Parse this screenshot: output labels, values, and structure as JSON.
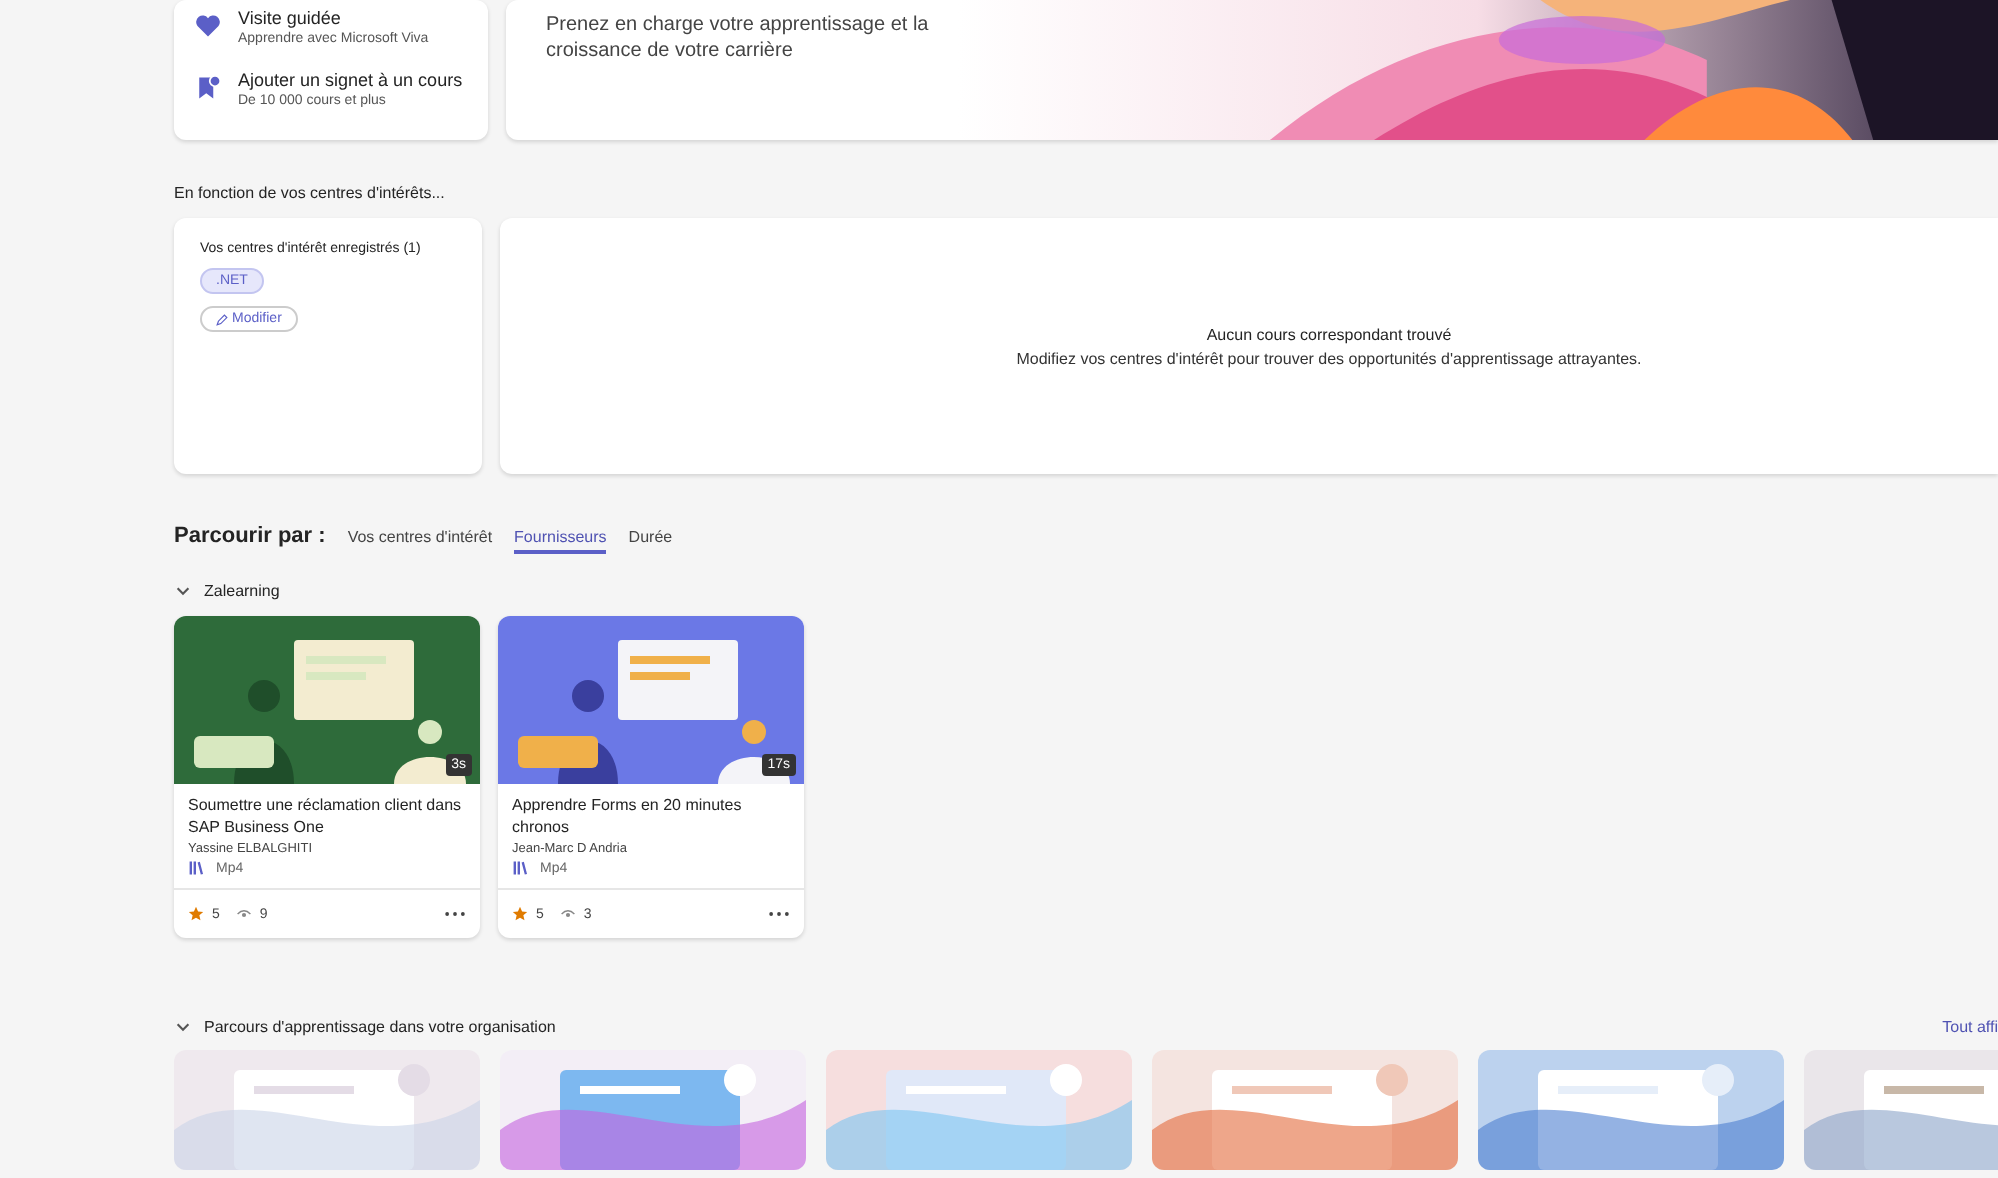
{
  "quick_links": [
    {
      "kind": "heart",
      "title": "Visite guidée",
      "subtitle": "Apprendre avec Microsoft Viva"
    },
    {
      "kind": "bookmark",
      "title": "Ajouter un signet à un cours",
      "subtitle": "De 10 000 cours et plus"
    }
  ],
  "hero": {
    "text": "Prenez en charge votre apprentissage et la croissance de votre carrière"
  },
  "interests": {
    "heading": "En fonction de vos centres d'intérêts...",
    "saved_label": "Vos centres d'intérêt enregistrés (1)",
    "tags": [
      ".NET"
    ],
    "edit_button": "Modifier",
    "empty_title": "Aucun cours correspondant trouvé",
    "empty_text": "Modifiez vos centres d'intérêt pour trouver des opportunités d'apprentissage attrayantes."
  },
  "browse": {
    "label": "Parcourir par :",
    "tabs": [
      {
        "label": "Vos centres d'intérêt",
        "selected": false
      },
      {
        "label": "Fournisseurs",
        "selected": true
      },
      {
        "label": "Durée",
        "selected": false
      }
    ]
  },
  "provider": {
    "name": "Zalearning",
    "expanded": true,
    "courses": [
      {
        "duration": "3s",
        "title": "Soumettre une réclamation client dans SAP Business One",
        "author": "Yassine ELBALGHITI",
        "format": "Mp4",
        "rating": "5",
        "views": "9"
      },
      {
        "duration": "17s",
        "title": "Apprendre Forms en 20 minutes chronos",
        "author": "Jean-Marc D Andria",
        "format": "Mp4",
        "rating": "5",
        "views": "3"
      }
    ]
  },
  "paths": {
    "title": "Parcours d'apprentissage dans votre organisation",
    "expanded": true,
    "link": "Tout affi"
  }
}
